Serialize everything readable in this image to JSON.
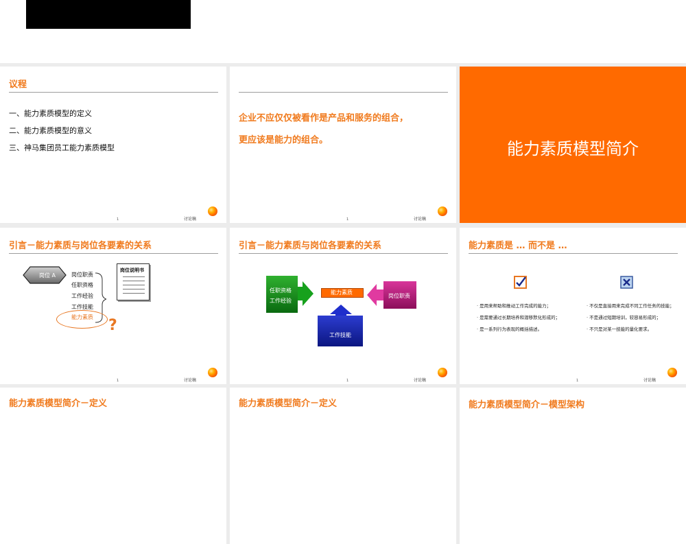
{
  "footer": {
    "page_num": "1",
    "draft_label": "讨论稿"
  },
  "slide1": {
    "title": "议程",
    "items": [
      "一、能力素质模型的定义",
      "二、能力素质模型的意义",
      "三、神马集团员工能力素质模型"
    ]
  },
  "slide2": {
    "lines": [
      "企业不应仅仅被看作是产品和服务的组合，",
      "更应该是能力的组合。"
    ]
  },
  "slide3": {
    "title": "能力素质模型简介"
  },
  "slide4": {
    "title": "引言－能力素质与岗位各要素的关系",
    "hex_label": "岗位 A",
    "items": [
      "岗位职责",
      "任职资格",
      "工作经验",
      "工作技能",
      "能力素质"
    ],
    "doc_title": "岗位说明书",
    "question": "?"
  },
  "slide5": {
    "title": "引言－能力素质与岗位各要素的关系",
    "green_lines": [
      "任职资格",
      "工作经验"
    ],
    "center": "能力素质",
    "magenta": "岗位职责",
    "blue": "工作技能"
  },
  "slide6": {
    "title": "能力素质是 … 而不是 …",
    "left_bullets": [
      "是用来帮助和推动工作完成的能力；",
      "是需要通过长期培养和潜移默化形成的；",
      "是一系列行为表现的概括描述。"
    ],
    "right_bullets": [
      "不仅是直接用来完成不同工作任务的技能；",
      "不是通过短期培训，较容易形成的；",
      "不只是对某一技能的量化要求。"
    ]
  },
  "slide7": {
    "title": "能力素质模型简介－定义"
  },
  "slide8": {
    "title": "能力素质模型简介－定义"
  },
  "slide9": {
    "title": "能力素质模型简介－模型架构"
  }
}
